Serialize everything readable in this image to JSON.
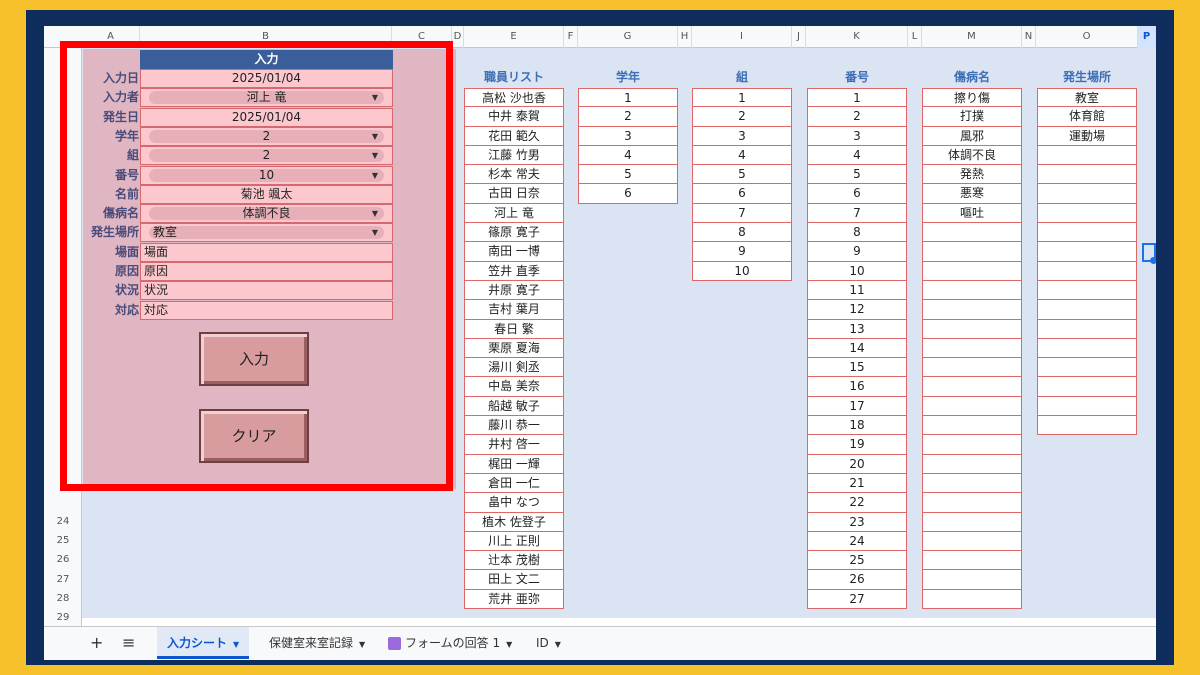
{
  "columns": [
    "A",
    "B",
    "C",
    "D",
    "E",
    "F",
    "G",
    "H",
    "I",
    "J",
    "K",
    "L",
    "M",
    "N",
    "O",
    "P"
  ],
  "visible_row_numbers": [
    "24",
    "25",
    "26",
    "27",
    "28",
    "29"
  ],
  "form": {
    "header": "入力",
    "rows": [
      {
        "label": "入力日",
        "value": "2025/01/04",
        "kind": "text"
      },
      {
        "label": "入力者",
        "value": "河上 竜",
        "kind": "dropdown"
      },
      {
        "label": "発生日",
        "value": "2025/01/04",
        "kind": "text"
      },
      {
        "label": "学年",
        "value": "2",
        "kind": "dropdown"
      },
      {
        "label": "組",
        "value": "2",
        "kind": "dropdown"
      },
      {
        "label": "番号",
        "value": "10",
        "kind": "dropdown"
      },
      {
        "label": "名前",
        "value": "菊池 颯太",
        "kind": "text"
      },
      {
        "label": "傷病名",
        "value": "体調不良",
        "kind": "dropdown"
      },
      {
        "label": "発生場所",
        "value": "教室",
        "kind": "dropdown-left"
      },
      {
        "label": "場面",
        "value": "場面",
        "kind": "input"
      },
      {
        "label": "原因",
        "value": "原因",
        "kind": "input"
      },
      {
        "label": "状況",
        "value": "状況",
        "kind": "input"
      },
      {
        "label": "対応",
        "value": "対応",
        "kind": "input"
      }
    ],
    "submit_label": "入力",
    "clear_label": "クリア"
  },
  "lists": {
    "staff": {
      "title": "職員リスト",
      "items": [
        "高松 沙也香",
        "中井 泰賀",
        "花田 範久",
        "江藤 竹男",
        "杉本 常夫",
        "古田 日奈",
        "河上 竜",
        "篠原 寛子",
        "南田 一博",
        "笠井 直季",
        "井原 寛子",
        "吉村 葉月",
        "春日 繁",
        "栗原 夏海",
        "湯川 剣丞",
        "中島 美奈",
        "船越 敏子",
        "藤川 恭一",
        "井村 啓一",
        "梶田 一輝",
        "倉田 一仁",
        "畠中 なつ",
        "植木 佐登子",
        "川上 正則",
        "辻本 茂樹",
        "田上 文二",
        "荒井 亜弥"
      ]
    },
    "grade": {
      "title": "学年",
      "items": [
        "1",
        "2",
        "3",
        "4",
        "5",
        "6"
      ]
    },
    "class": {
      "title": "組",
      "items": [
        "1",
        "2",
        "3",
        "4",
        "5",
        "6",
        "7",
        "8",
        "9",
        "10"
      ]
    },
    "number": {
      "title": "番号",
      "items": [
        "1",
        "2",
        "3",
        "4",
        "5",
        "6",
        "7",
        "8",
        "9",
        "10",
        "11",
        "12",
        "13",
        "14",
        "15",
        "16",
        "17",
        "18",
        "19",
        "20",
        "21",
        "22",
        "23",
        "24",
        "25",
        "26",
        "27"
      ]
    },
    "injury": {
      "title": "傷病名",
      "items": [
        "擦り傷",
        "打撲",
        "風邪",
        "体調不良",
        "発熱",
        "悪寒",
        "嘔吐",
        "",
        "",
        "",
        "",
        "",
        "",
        "",
        "",
        "",
        "",
        "",
        "",
        "",
        "",
        "",
        "",
        "",
        "",
        "",
        ""
      ]
    },
    "place": {
      "title": "発生場所",
      "items": [
        "教室",
        "体育館",
        "運動場",
        "",
        "",
        "",
        "",
        "",
        "",
        "",
        "",
        "",
        "",
        "",
        "",
        "",
        "",
        ""
      ]
    }
  },
  "tabs": {
    "add_icon": "plus-icon",
    "menu_icon": "hamburger-menu-icon",
    "items": [
      {
        "label": "入力シート",
        "active": true
      },
      {
        "label": "保健室来室記録",
        "active": false
      },
      {
        "label": "フォームの回答 1",
        "active": false,
        "icon": "form-icon"
      },
      {
        "label": "ID",
        "active": false
      }
    ]
  },
  "colors": {
    "accent": "#ff0000",
    "header_blue": "#3a5e9a",
    "cell_pink": "#fcc8ce",
    "panel_pink": "#e0b6c3",
    "grid_blue": "#dbe4f3"
  }
}
